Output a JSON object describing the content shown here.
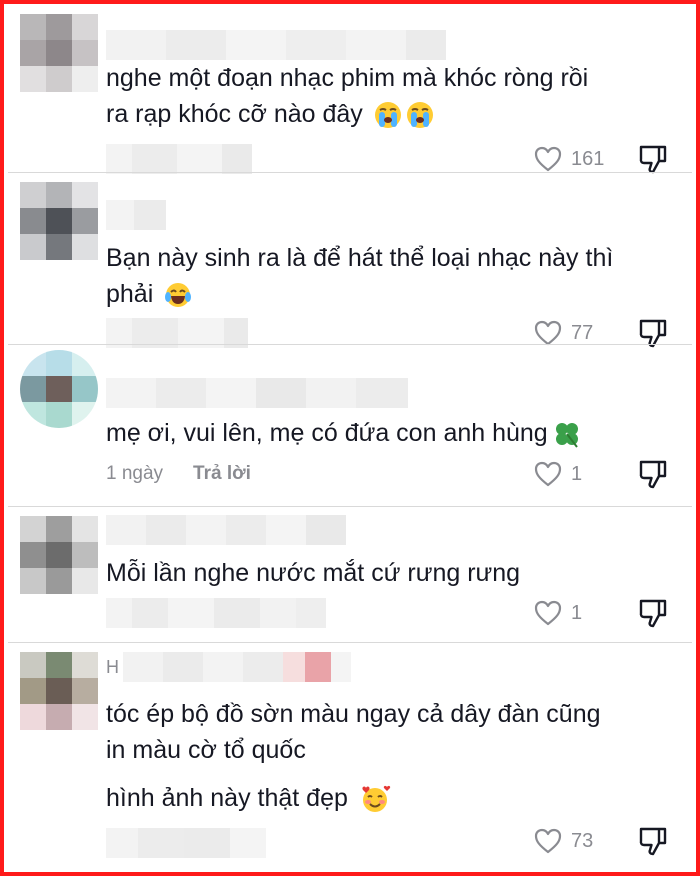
{
  "colors": {
    "border": "#ff1a1a",
    "text": "#161823",
    "muted": "#8a8b91",
    "divider": "#d9d9d9"
  },
  "comments": [
    {
      "name": "",
      "text_lines": [
        "nghe một đoạn nhạc phim mà khóc ròng rồi",
        "ra rạp khóc cỡ nào đây"
      ],
      "date": "",
      "reply_label": "",
      "likes": "161",
      "emoji": [
        "loudly-crying-face",
        "loudly-crying-face"
      ]
    },
    {
      "name": "",
      "text_lines": [
        "Bạn này sinh ra là để hát thể loại nhạc này thì",
        "phải"
      ],
      "date": "",
      "reply_label": "",
      "likes": "77",
      "emoji": [
        "tears-of-joy-face"
      ]
    },
    {
      "name": "",
      "text_lines": [
        "mẹ ơi, vui lên, mẹ có đứa con anh hùng"
      ],
      "date": "1 ngày",
      "reply_label": "Trả lời",
      "likes": "1",
      "emoji": [
        "four-leaf-clover"
      ]
    },
    {
      "name": "",
      "text_lines": [
        "Mỗi lần nghe nước mắt cứ rưng rưng"
      ],
      "date": "",
      "reply_label": "",
      "likes": "1",
      "emoji": []
    },
    {
      "name": "H",
      "text_lines": [
        "tóc ép bộ đồ sờn màu ngay cả dây đàn cũng",
        "in màu cờ tổ quốc"
      ],
      "extra_line": "hình ảnh này thật đẹp",
      "date": "",
      "reply_label": "",
      "likes": "73",
      "emoji": [
        "smiling-face-with-hearts"
      ]
    }
  ]
}
